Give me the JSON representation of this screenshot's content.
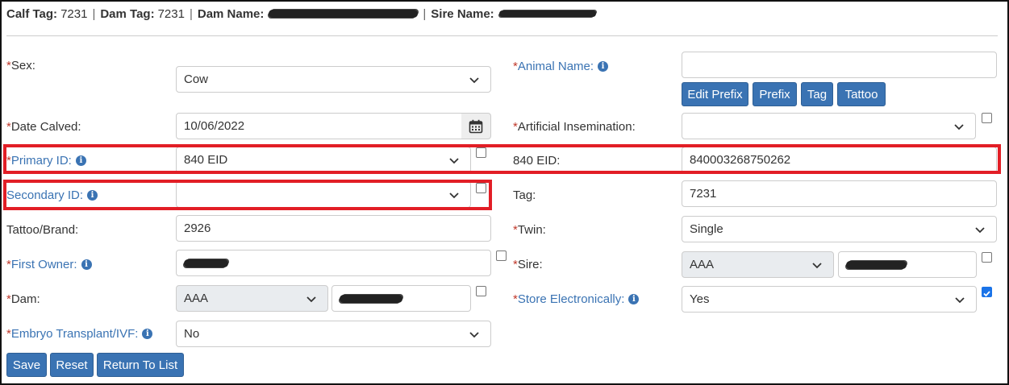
{
  "header": {
    "calf_tag_label": "Calf Tag:",
    "calf_tag_value": "7231",
    "dam_tag_label": "Dam Tag:",
    "dam_tag_value": "7231",
    "dam_name_label": "Dam Name:",
    "sire_name_label": "Sire Name:",
    "separator": "|"
  },
  "form": {
    "sex": {
      "label": "Sex:",
      "value": "Cow"
    },
    "animal_name": {
      "label": "Animal Name:",
      "value": ""
    },
    "name_buttons": {
      "edit_prefix": "Edit Prefix",
      "prefix": "Prefix",
      "tag": "Tag",
      "tattoo": "Tattoo"
    },
    "date_calved": {
      "label": "Date Calved:",
      "value": "10/06/2022"
    },
    "artificial_insemination": {
      "label": "Artificial Insemination:",
      "value": ""
    },
    "primary_id": {
      "label": "Primary ID:",
      "value": "840 EID"
    },
    "eid_840": {
      "label": "840 EID:",
      "value": "840003268750262"
    },
    "secondary_id": {
      "label": "Secondary ID:",
      "value": ""
    },
    "tag": {
      "label": "Tag:",
      "value": "7231"
    },
    "tattoo_brand": {
      "label": "Tattoo/Brand:",
      "value": "2926"
    },
    "twin": {
      "label": "Twin:",
      "value": "Single"
    },
    "first_owner": {
      "label": "First Owner:"
    },
    "sire": {
      "label": "Sire:",
      "breed": "AAA"
    },
    "dam": {
      "label": "Dam:",
      "breed": "AAA"
    },
    "store_electronically": {
      "label": "Store Electronically:",
      "value": "Yes"
    },
    "embryo_transplant": {
      "label": "Embryo Transplant/IVF:",
      "value": "No"
    },
    "required_mark": "*"
  },
  "actions": {
    "save": "Save",
    "reset": "Reset",
    "return_to_list": "Return To List"
  },
  "colors": {
    "accent": "#3a73b3",
    "required": "#c0392b",
    "highlight": "#e21e26"
  }
}
